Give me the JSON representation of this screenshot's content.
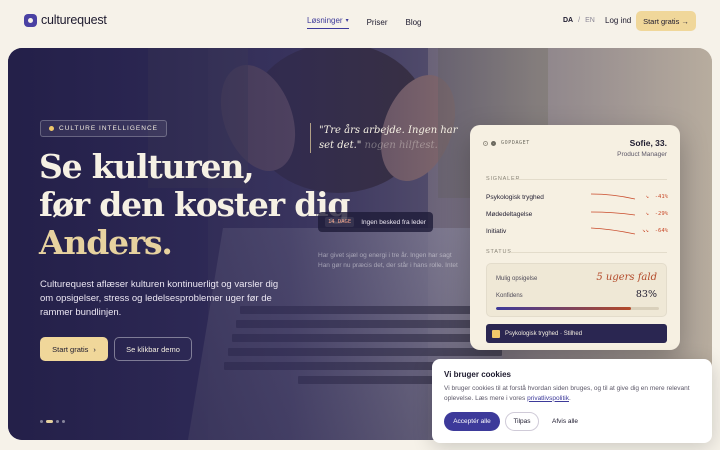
{
  "brand": {
    "name": "culturequest",
    "logo_icon": "culturequest-logo-icon",
    "accent": "#3d3a9a",
    "cta_color": "#f0d79a"
  },
  "nav": {
    "links": [
      {
        "label": "Løsninger",
        "active": true,
        "has_dropdown": true
      },
      {
        "label": "Priser"
      },
      {
        "label": "Blog"
      }
    ],
    "lang_active": "DA",
    "lang_sep": "/",
    "lang_other": "EN",
    "login": "Log ind",
    "cta": "Start gratis →"
  },
  "hero": {
    "badge": "CULTURE INTELLIGENCE",
    "title_line1": "Se kulturen,",
    "title_line2": "før den koster dig",
    "title_line3": "Anders.",
    "lead": "Culturequest aflæser kulturen kontinuerligt og varsler dig om opsigelser, stress og ledelsesproblemer uger før de rammer bundlinjen.",
    "primary_button": "Start gratis",
    "primary_arrow": "›",
    "secondary_button": "Se klikbar demo",
    "quote_lit": "\"Tre års arbejde. Ingen har set det.\"",
    "quote_dim": " nogen hilftest.",
    "tag_days": "14 DAGE",
    "tag_text": "Ingen besked fra leder",
    "faded_line1": "Har givet sjæl og energi i tre år. Ingen har sagt",
    "faded_line2": "Han gør nu præcis det, der står i hans rolle. Intet"
  },
  "card": {
    "flag": "GOPDAGET",
    "name": "Sofie, 33.",
    "role": "Product Manager",
    "signals_label": "SIGNALER",
    "signals": [
      {
        "name": "Psykologisk tryghed",
        "arrow": "↘",
        "value": "-41%"
      },
      {
        "name": "Mødedeltagelse",
        "arrow": "↘",
        "value": "-29%"
      },
      {
        "name": "Initiativ",
        "arrow": "↘↘",
        "value": "-64%"
      }
    ],
    "status_label": "STATUS",
    "status_rows": [
      {
        "label": "Mulig opsigelse",
        "value": "5 ugers fald"
      },
      {
        "label": "Konfidens",
        "value": "83%"
      }
    ],
    "confidence": 0.83,
    "footer": "Psykologisk tryghed · Stilhed"
  },
  "cookie": {
    "title": "Vi bruger cookies",
    "body": "Vi bruger cookies til at forstå hvordan siden bruges, og til at give dig en mere relevant oplevelse. Læs mere i vores ",
    "link": "privatlivspolitik",
    "link_suffix": ".",
    "accept": "Acceptér alle",
    "adjust": "Tilpas",
    "reject": "Afvis alle"
  },
  "carousel": {
    "slides": 4,
    "active": 1
  }
}
